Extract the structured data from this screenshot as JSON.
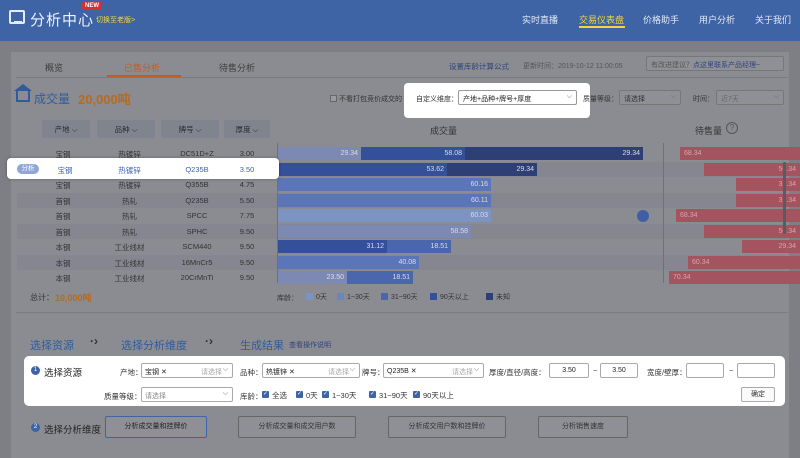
{
  "header": {
    "logo_text": "分析中心",
    "new_badge": "NEW",
    "switch_link": "切换至老版>",
    "nav": [
      "实时直播",
      "交易仪表盘",
      "价格助手",
      "用户分析",
      "关于我们"
    ],
    "active_nav": "交易仪表盘"
  },
  "tabs": [
    "概览",
    "已售分析",
    "待售分析"
  ],
  "active_tab": "已售分析",
  "toolbar": {
    "formula_link": "设置库龄计算公式",
    "update_time": "更新时间：2019-10-12 11:00:05",
    "contact_prefix": "有改进建议？",
    "contact_link": "点这里联系产品经理~"
  },
  "volume": {
    "label": "成交量",
    "value": "20,000吨"
  },
  "filters": {
    "exclude_label": "不看打包竞价成交的",
    "custom_dim_label": "自定义维度：",
    "custom_dim_value": "产地+品种+牌号+厚度",
    "quality_label": "质量等级：",
    "quality_value": "请选择",
    "time_label": "时间：",
    "time_value": "近7天"
  },
  "table": {
    "columns": [
      "产地",
      "品种",
      "牌号",
      "厚度"
    ],
    "volume_header": "成交量",
    "stock_header": "待售量",
    "help_icon": "?",
    "highlight_badge": "分析",
    "rows": [
      {
        "origin": "宝钢",
        "variety": "热镀锌",
        "grade": "DC51D+Z",
        "thickness": "3.00",
        "segs": [
          {
            "v": "29.34"
          },
          {
            "v": "58.08"
          },
          {
            "v": "29.34"
          }
        ],
        "stock": "68.34"
      },
      {
        "origin": "宝钢",
        "variety": "热镀锌",
        "grade": "Q235B",
        "thickness": "3.50",
        "segs": [
          {
            "v": "53.62"
          },
          {
            "v": "29.34"
          }
        ],
        "stock": "50.34"
      },
      {
        "origin": "宝钢",
        "variety": "热镀锌",
        "grade": "Q355B",
        "thickness": "4.75",
        "segs": [
          {
            "v": "60.16"
          }
        ],
        "stock": "32.34"
      },
      {
        "origin": "首钢",
        "variety": "热轧",
        "grade": "Q235B",
        "thickness": "5.50",
        "segs": [
          {
            "v": "60.11"
          }
        ],
        "stock": "32.34"
      },
      {
        "origin": "首钢",
        "variety": "热轧",
        "grade": "SPCC",
        "thickness": "7.75",
        "segs": [
          {
            "v": "60.03"
          }
        ],
        "stock": "68.34"
      },
      {
        "origin": "首钢",
        "variety": "热轧",
        "grade": "SPHC",
        "thickness": "9.50",
        "segs": [
          {
            "v": "58.58"
          }
        ],
        "stock": "50.34"
      },
      {
        "origin": "本钢",
        "variety": "工业线材",
        "grade": "SCM440",
        "thickness": "9.50",
        "segs": [
          {
            "v": "31.12"
          },
          {
            "v": "18.51"
          }
        ],
        "stock": "29.34"
      },
      {
        "origin": "本钢",
        "variety": "工业线材",
        "grade": "16MnCr5",
        "thickness": "9.50",
        "segs": [
          {
            "v": "40.08"
          }
        ],
        "stock": "60.34"
      },
      {
        "origin": "本钢",
        "variety": "工业线材",
        "grade": "20CrMnTi",
        "thickness": "9.50",
        "segs": [
          {
            "v": "23.50"
          },
          {
            "v": "18.51"
          }
        ],
        "stock": "70.34"
      }
    ]
  },
  "total": {
    "label": "总计：",
    "value": "10,000吨"
  },
  "age_legend": {
    "label": "库龄：",
    "items": [
      "0天",
      "1~30天",
      "31~90天",
      "90天以上",
      "未知"
    ],
    "colors": [
      "#7d93c2",
      "#6d85bd",
      "#4a67ad",
      "#34509a",
      "#2e3f76"
    ]
  },
  "steps": {
    "s1": "选择资源",
    "s2": "选择分析维度",
    "s3": "生成结果",
    "guide_link": "查看操作说明"
  },
  "resource_panel": {
    "num": "1",
    "title": "选择资源",
    "origin_label": "产地：",
    "origin_tag": "宝钢",
    "origin_placeholder": "请选择",
    "variety_label": "品种：",
    "variety_tag": "热镀锌",
    "variety_placeholder": "请选择",
    "grade_label": "牌号：",
    "grade_tag": "Q235B",
    "grade_placeholder": "请选择",
    "thickness_label": "厚度/直径/高度：",
    "thickness_min": "3.50",
    "thickness_max": "3.50",
    "width_label": "宽度/壁厚：",
    "width_min": "",
    "width_max": "",
    "range_sep": "~",
    "quality_label": "质量等级：",
    "quality_placeholder": "请选择",
    "age_label": "库龄：",
    "age_options": [
      "全选",
      "0天",
      "1~30天",
      "31~90天",
      "90天以上"
    ],
    "confirm": "确定"
  },
  "analysis": {
    "num": "2",
    "title": "选择分析维度",
    "buttons": [
      "分析成交量和挂牌价",
      "分析成交量和成交用户数",
      "分析成交用户数和挂牌价",
      "分析销售速度"
    ]
  },
  "colors": {
    "nav_bg": "#3e64a6",
    "accent_orange": "#c25d20",
    "stock_red": "#a3545e"
  }
}
